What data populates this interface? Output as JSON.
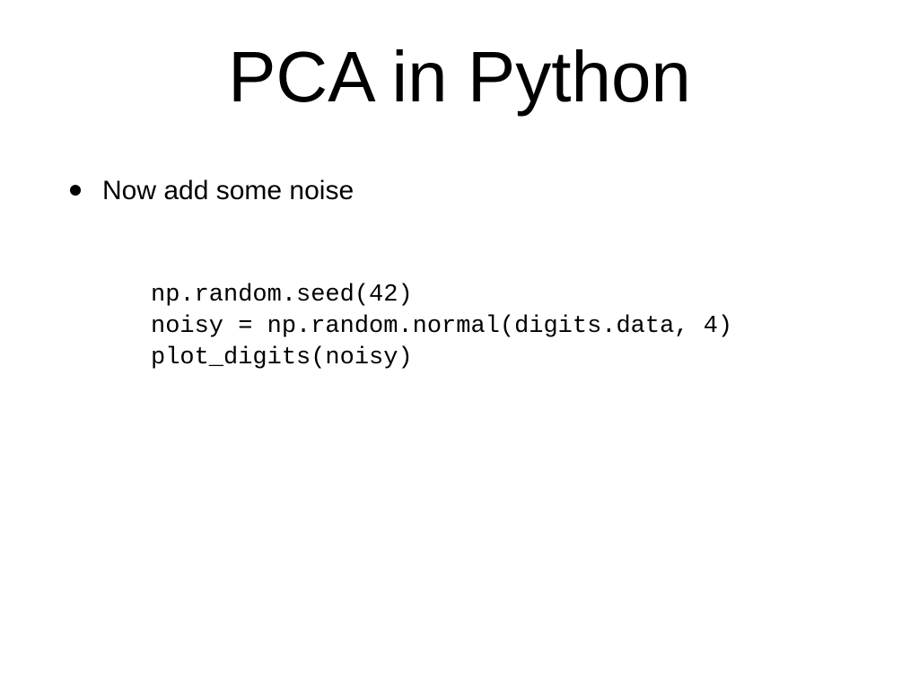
{
  "title": "PCA in Python",
  "bullet": {
    "text": "Now add some noise"
  },
  "code": {
    "line1": "np.random.seed(42)",
    "line2": "noisy = np.random.normal(digits.data, 4)",
    "line3": "plot_digits(noisy)"
  }
}
